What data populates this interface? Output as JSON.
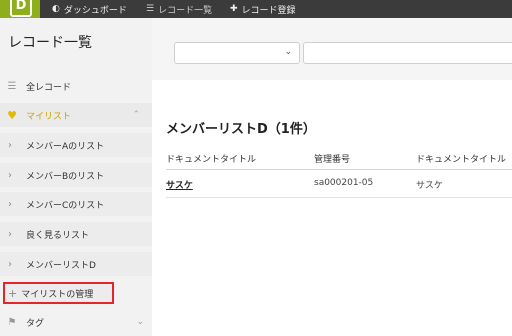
{
  "topbar": {
    "logo_icon": "app-logo",
    "nav": [
      {
        "label": "ダッシュボード",
        "icon": "dashboard-gauge-icon"
      },
      {
        "label": "レコード一覧",
        "icon": "list-icon"
      },
      {
        "label": "レコード登録",
        "icon": "plus-icon"
      }
    ]
  },
  "sidebar": {
    "title": "レコード一覧",
    "all_records": "全レコード",
    "mylist": {
      "label": "マイリスト",
      "icon": "heart-icon",
      "color": "#e3b800"
    },
    "items": [
      "メンバーAのリスト",
      "メンバーBのリスト",
      "メンバーCのリスト",
      "良く見るリスト",
      "メンバーリストD"
    ],
    "manage": "マイリストの管理",
    "tag": "タグ"
  },
  "filter": {
    "select_value": "",
    "search_value": ""
  },
  "main": {
    "title": "メンバーリストD（1件）",
    "columns": [
      "ドキュメントタイトル",
      "管理番号",
      "ドキュメントタイトル"
    ],
    "rows": [
      {
        "title_link": "サスケ",
        "number": "sa000201-05",
        "title": "サスケ"
      }
    ]
  },
  "colors": {
    "topbar": "#3b3b3b",
    "logo": "#8fae1b",
    "highlight_border": "#e4252a"
  }
}
